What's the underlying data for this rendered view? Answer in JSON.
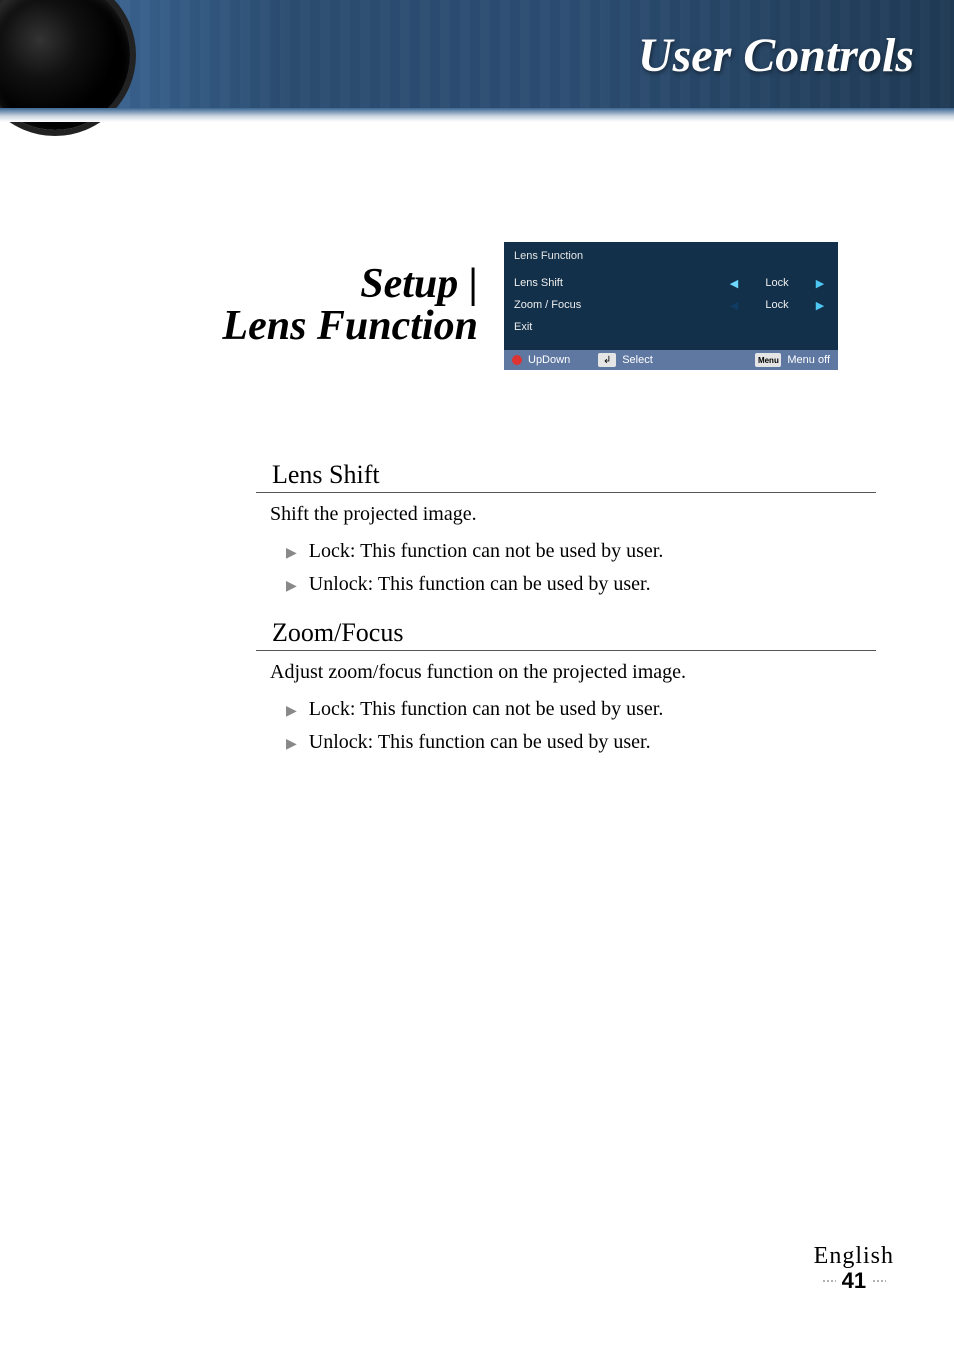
{
  "header": {
    "title": "User Controls"
  },
  "section": {
    "line1": "Setup |",
    "line2": "Lens Function"
  },
  "osd": {
    "title": "Lens Function",
    "rows": [
      {
        "label": "Lens Shift",
        "value": "Lock"
      },
      {
        "label": "Zoom / Focus",
        "value": "Lock"
      },
      {
        "label": "Exit",
        "value": ""
      }
    ],
    "footer": {
      "updown": "UpDown",
      "select": "Select",
      "menu_key": "Menu",
      "menuoff": "Menu off"
    }
  },
  "content": {
    "lens_shift": {
      "heading": "Lens Shift",
      "desc": "Shift the projected image.",
      "bullets": [
        "Lock: This function can not be used by user.",
        "Unlock: This function can be used by user."
      ]
    },
    "zoom_focus": {
      "heading": "Zoom/Focus",
      "desc": "Adjust zoom/focus function on the projected image.",
      "bullets": [
        "Lock: This function can not be used by user.",
        "Unlock: This function can be used by user."
      ]
    }
  },
  "footer": {
    "language": "English",
    "page_number": "41"
  }
}
